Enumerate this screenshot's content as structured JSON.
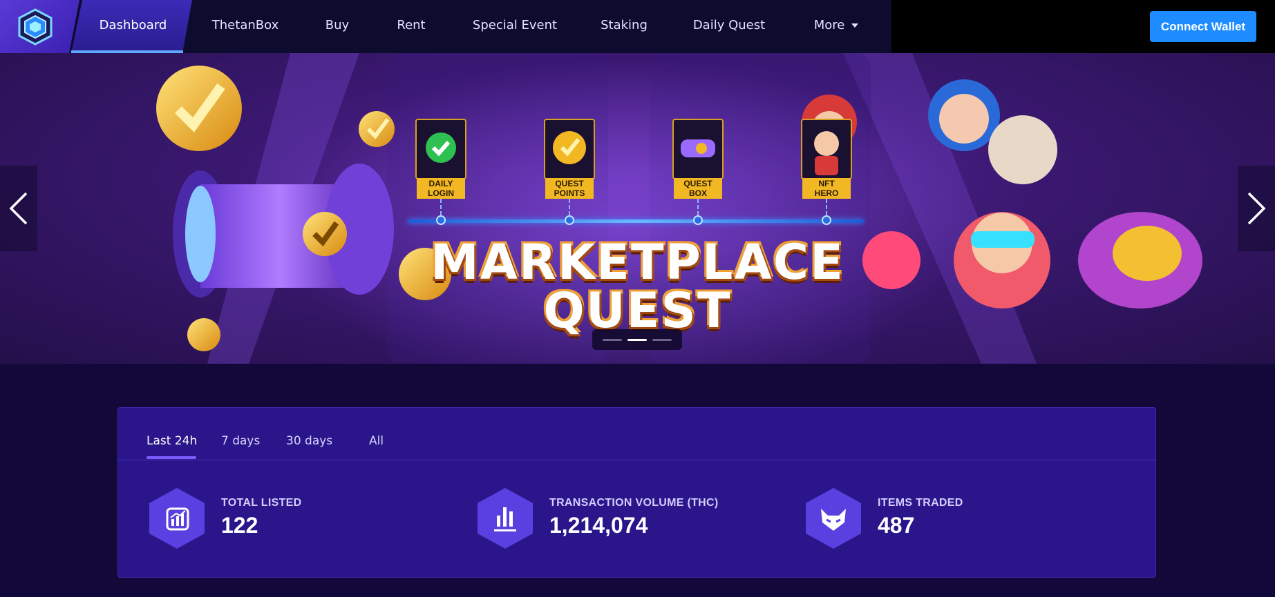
{
  "nav": {
    "items": [
      {
        "label": "Dashboard",
        "active": true
      },
      {
        "label": "ThetanBox"
      },
      {
        "label": "Buy"
      },
      {
        "label": "Rent"
      },
      {
        "label": "Special Event"
      },
      {
        "label": "Staking"
      },
      {
        "label": "Daily Quest"
      },
      {
        "label": "More"
      }
    ],
    "connect_label": "Connect Wallet"
  },
  "banner": {
    "title_line1": "MARKETPLACE",
    "title_line2": "QUEST",
    "cards": [
      {
        "line1": "DAILY",
        "line2": "LOGIN"
      },
      {
        "line1": "QUEST",
        "line2": "POINTS"
      },
      {
        "line1": "QUEST",
        "line2": "BOX"
      },
      {
        "line1": "NFT",
        "line2": "HERO"
      }
    ],
    "active_slide": 1,
    "slide_count": 3
  },
  "stats": {
    "tabs": [
      {
        "label": "Last 24h",
        "active": true
      },
      {
        "label": "7 days"
      },
      {
        "label": "30 days"
      },
      {
        "label": "All"
      }
    ],
    "items": [
      {
        "label": "TOTAL LISTED",
        "value": "122",
        "icon": "chart-growth-icon"
      },
      {
        "label": "TRANSACTION VOLUME (THC)",
        "value": "1,214,074",
        "icon": "bar-chart-icon"
      },
      {
        "label": "ITEMS TRADED",
        "value": "487",
        "icon": "demon-mask-icon"
      }
    ]
  },
  "colors": {
    "accent": "#1e8cff",
    "panel": "#2a168a",
    "page_bg": "#12093a",
    "hex_icon": "#5a40e0"
  }
}
